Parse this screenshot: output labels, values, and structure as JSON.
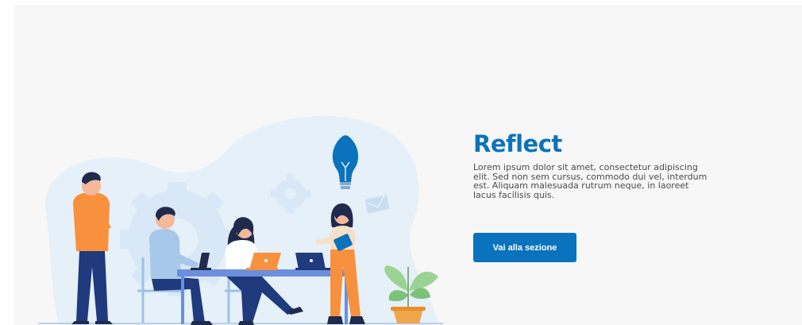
{
  "section": {
    "title": "Reflect",
    "description": "Lorem ipsum dolor sit amet, consectetur adipiscing elit. Sed non sem cursus, commodo dui vel, interdum est. Aliquam malesuada rutrum neque, in laoreet lacus facilisis quis.",
    "button_label": "Vai alla sezione"
  },
  "colors": {
    "panel_background": "#f7f7f7",
    "accent": "#0b73bd",
    "text": "#4a4a4a",
    "blob": "#e6f0f9"
  },
  "illustration": {
    "subject": "team-meeting-illustration",
    "icons": [
      "lightbulb-icon",
      "gear-icon",
      "envelope-icon",
      "plant-icon",
      "laptop-icon"
    ]
  }
}
